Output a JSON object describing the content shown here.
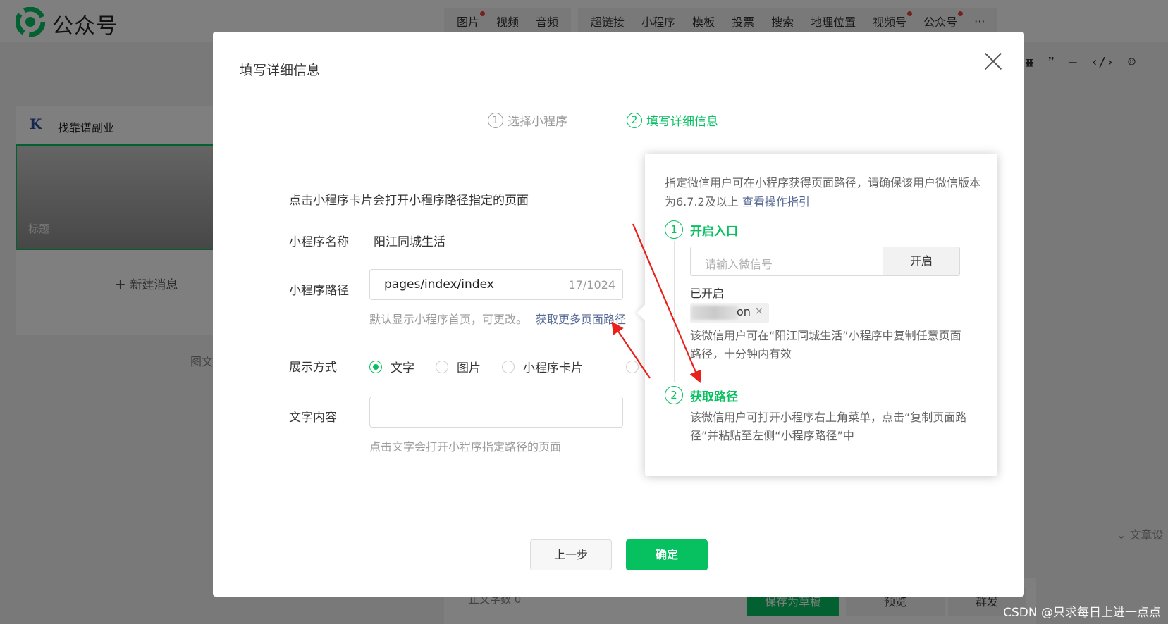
{
  "brand": {
    "name": "公众号"
  },
  "toolbar": {
    "media": [
      "图片",
      "视频",
      "音频"
    ],
    "insert": [
      "超链接",
      "小程序",
      "模板",
      "投票",
      "搜索",
      "地理位置",
      "视频号",
      "公众号",
      "···"
    ]
  },
  "editor_icons": [
    "table-icon",
    "quote-icon",
    "divider-icon",
    "code-icon",
    "emoji-icon"
  ],
  "left_panel": {
    "account_name": "找靠谱副业",
    "cover_title": "标题",
    "new_message": "＋ 新建消息",
    "side_label": "图文"
  },
  "background": {
    "article_settings": "文章设",
    "word_count": "正文字数 0",
    "save_draft": "保存为草稿",
    "preview": "预览",
    "mass_send": "群发"
  },
  "watermark": "CSDN @只求每日上进一点点",
  "dialog": {
    "title": "填写详细信息",
    "steps": [
      {
        "num": "1",
        "label": "选择小程序"
      },
      {
        "num": "2",
        "label": "填写详细信息"
      }
    ],
    "intro": "点击小程序卡片会打开小程序路径指定的页面",
    "name_label": "小程序名称",
    "name_value": "阳江同城生活",
    "path_label": "小程序路径",
    "path_value": "pages/index/index",
    "path_count": "17/1024",
    "path_hint": "默认显示小程序首页，可更改。",
    "path_link": "获取更多页面路径",
    "display_label": "展示方式",
    "display_options": [
      "文字",
      "图片",
      "小程序卡片"
    ],
    "display_selected": "文字",
    "text_label": "文字内容",
    "text_value": "",
    "text_hint": "点击文字会打开小程序指定路径的页面",
    "prev_button": "上一步",
    "ok_button": "确定"
  },
  "popover": {
    "desc": "指定微信用户可在小程序获得页面路径，请确保该用户微信版本为6.7.2及以上",
    "desc_link": "查看操作指引",
    "step1": {
      "num": "1",
      "title": "开启入口"
    },
    "input_placeholder": "请输入微信号",
    "open_button": "开启",
    "opened_label": "已开启",
    "tag_text": "on",
    "tag_close": "×",
    "note1": "该微信用户可在“阳江同城生活”小程序中复制任意页面路径，十分钟内有效",
    "step2": {
      "num": "2",
      "title": "获取路径"
    },
    "note2": "该微信用户可打开小程序右上角菜单，点击“复制页面路径”并粘贴至左侧“小程序路径”中"
  },
  "colors": {
    "accent": "#07c160",
    "link": "#576b95",
    "annotation": "#e8211b",
    "notification_dot": "#e64340"
  }
}
